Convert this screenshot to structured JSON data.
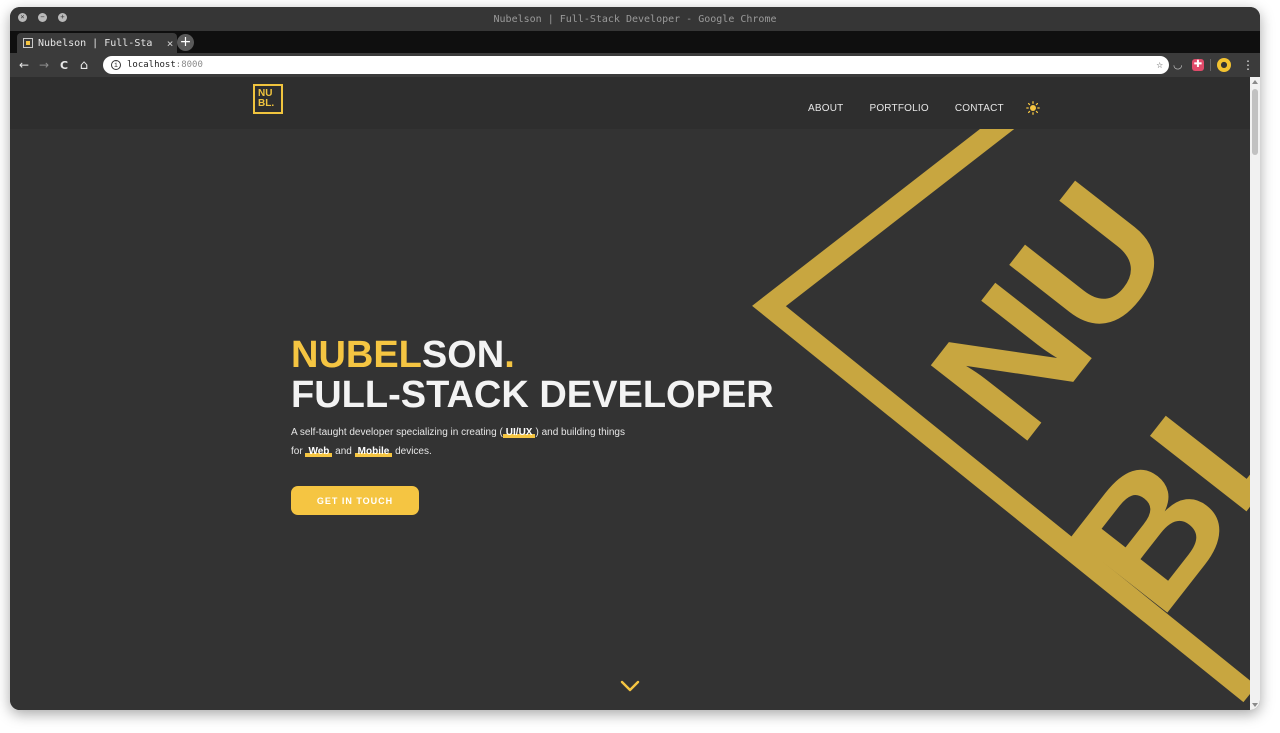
{
  "window": {
    "title": "Nubelson | Full-Stack Developer - Google Chrome"
  },
  "tab": {
    "title": "Nubelson | Full-Sta",
    "close": "×",
    "new_tab": "+"
  },
  "toolbar": {
    "back": "←",
    "forward": "→",
    "reload": "C",
    "home": "⌂",
    "info": "i",
    "url_host": "localhost",
    "url_port": ":8000",
    "star": "☆",
    "menu": "⋮"
  },
  "site": {
    "logo": {
      "line1": "NU",
      "line2": "BL."
    },
    "nav": [
      "ABOUT",
      "PORTFOLIO",
      "CONTACT"
    ],
    "theme_toggle_icon": "sun-icon",
    "hero": {
      "title_gold": "NUBEL",
      "title_rest": "SON",
      "title_dot": ".",
      "subtitle": "FULL-STACK DEVELOPER",
      "desc_1": "A self-taught developer specializing in creating (",
      "desc_hl1": "UI/UX",
      "desc_2": ") and building things for ",
      "desc_hl2": "Web",
      "desc_3": " and ",
      "desc_hl3": "Mobile",
      "desc_4": " devices.",
      "cta": "GET IN TOUCH"
    },
    "background_logo": {
      "line1": "NU",
      "line2": "BL"
    },
    "scroll_icon": "chevron-down-icon"
  },
  "colors": {
    "accent": "#f5c542",
    "art": "#c8a640",
    "background": "#333333",
    "nav_bg": "#2e2e2e"
  }
}
